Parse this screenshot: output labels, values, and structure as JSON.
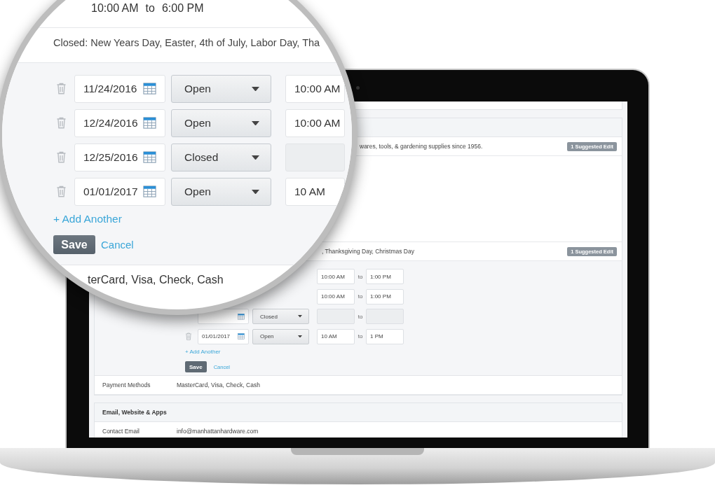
{
  "magnifier": {
    "hours": {
      "from": "10:00 AM",
      "separator": "to",
      "to": "6:00 PM"
    },
    "closed_note": "Closed: New Years Day, Easter, 4th of July, Labor Day, Tha",
    "special_hours": [
      {
        "date": "11/24/2016",
        "status": "Open",
        "from": "10:00 AM",
        "closed": false
      },
      {
        "date": "12/24/2016",
        "status": "Open",
        "from": "10:00 AM",
        "closed": false
      },
      {
        "date": "12/25/2016",
        "status": "Closed",
        "closed": true
      },
      {
        "date": "01/01/2017",
        "status": "Open",
        "from": "10 AM",
        "closed": false
      }
    ],
    "add_link": "+ Add Another",
    "save": "Save",
    "cancel": "Cancel",
    "payment": "terCard, Visa, Check, Cash"
  },
  "screen": {
    "description": {
      "text": "wares, tools, & gardening supplies since 1956.",
      "badge": "1 Suggested Edit"
    },
    "holidays": {
      "text": ", Thanksgiving Day, Christmas Day",
      "badge": "1 Suggested Edit"
    },
    "special_hours": [
      {
        "from": "10:00 AM",
        "separator": "to",
        "to": "1:00 PM",
        "closed": false
      },
      {
        "from": "10:00 AM",
        "separator": "to",
        "to": "1:00 PM",
        "closed": false
      },
      {
        "status": "Closed",
        "separator": "to",
        "closed": true
      },
      {
        "date": "01/01/2017",
        "status": "Open",
        "from": "10 AM",
        "separator": "to",
        "to": "1 PM",
        "closed": false
      }
    ],
    "add_link": "+ Add Another",
    "save": "Save",
    "cancel": "Cancel",
    "payment_methods": {
      "label": "Payment Methods",
      "value": "MasterCard, Visa, Check, Cash"
    },
    "email_section": {
      "title": "Email, Website & Apps",
      "rows": [
        {
          "label": "Contact Email",
          "value": "info@manhattanhardware.com"
        }
      ]
    }
  }
}
